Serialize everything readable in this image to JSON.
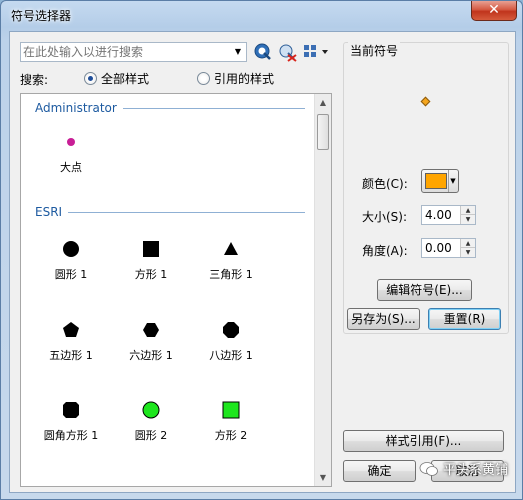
{
  "window": {
    "title": "符号选择器",
    "close_label": "✕"
  },
  "search": {
    "placeholder": "在此处输入以进行搜索",
    "label": "搜索:",
    "scope_all": "全部样式",
    "scope_referenced": "引用的样式",
    "selected_scope": "全部样式"
  },
  "groups": [
    {
      "name": "Administrator",
      "symbols": [
        {
          "label": "大点",
          "shape": "dot",
          "color": "#c81e96"
        }
      ]
    },
    {
      "name": "ESRI",
      "symbols": [
        {
          "label": "圆形 1",
          "shape": "circle",
          "color": "#000000"
        },
        {
          "label": "方形 1",
          "shape": "square",
          "color": "#000000"
        },
        {
          "label": "三角形 1",
          "shape": "triangle",
          "color": "#000000"
        },
        {
          "label": "五边形 1",
          "shape": "pentagon",
          "color": "#000000"
        },
        {
          "label": "六边形 1",
          "shape": "hexagon",
          "color": "#000000"
        },
        {
          "label": "八边形 1",
          "shape": "octagon",
          "color": "#000000"
        },
        {
          "label": "圆角方形 1",
          "shape": "rounded-square",
          "color": "#000000"
        },
        {
          "label": "圆形 2",
          "shape": "circle",
          "color": "#1ee61e"
        },
        {
          "label": "方形 2",
          "shape": "square",
          "color": "#1ee61e"
        }
      ]
    }
  ],
  "current_symbol": {
    "title": "当前符号",
    "preview_color": "#f5a51c",
    "color_label": "颜色(C):",
    "color_value": "#ffa500",
    "size_label": "大小(S):",
    "size_value": "4.00",
    "angle_label": "角度(A):",
    "angle_value": "0.00"
  },
  "buttons": {
    "edit_symbol": "编辑符号(E)...",
    "save_as": "另存为(S)...",
    "reset": "重置(R)",
    "style_references": "样式引用(F)...",
    "ok": "确定",
    "cancel": "取消"
  },
  "watermark": {
    "text": "平头系黄铺"
  }
}
